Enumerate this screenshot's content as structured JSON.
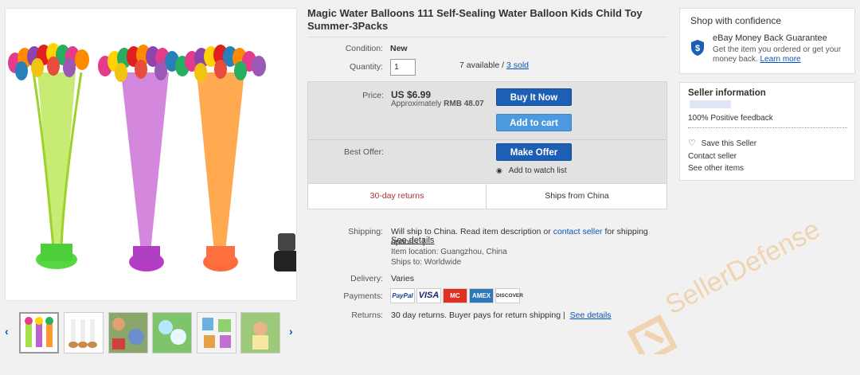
{
  "listing": {
    "title": "Magic Water Balloons 111 Self-Sealing Water Balloon Kids Child Toy Summer-3Packs"
  },
  "condition": {
    "label": "Condition:",
    "value": "New"
  },
  "quantity": {
    "label": "Quantity:",
    "value": "1",
    "available": "7 available /",
    "sold": "3 sold"
  },
  "price": {
    "label": "Price:",
    "value": "US $6.99",
    "approx_label": "Approximately",
    "approx_value": "RMB 48.07"
  },
  "buttons": {
    "buy_now": "Buy It Now",
    "add_to_cart": "Add to cart",
    "make_offer": "Make Offer",
    "watch": "Add to watch list"
  },
  "best_offer": {
    "label": "Best Offer:"
  },
  "strip": {
    "returns": "30-day returns",
    "ships_from": "Ships from China"
  },
  "shipping": {
    "label": "Shipping:",
    "text1": "Will ship to China. Read item description or",
    "contact": "contact seller",
    "text2": "for shipping options. |",
    "see_details": "See details",
    "item_location": "Item location:  Guangzhou, China",
    "ships_to": "Ships to:  Worldwide"
  },
  "delivery": {
    "label": "Delivery:",
    "value": "Varies"
  },
  "payments": {
    "label": "Payments:",
    "methods": [
      "PayPal",
      "VISA",
      "MC",
      "AMEX",
      "DISCOVER"
    ]
  },
  "returns": {
    "label": "Returns:",
    "text": "30 day returns. Buyer pays for return shipping |",
    "see_details": "See details"
  },
  "confidence": {
    "heading": "Shop with confidence",
    "guarantee_title": "eBay Money Back Guarantee",
    "guarantee_text": "Get the item you ordered or get your money back.",
    "learn_more": "Learn more"
  },
  "seller": {
    "heading": "Seller information",
    "feedback": "100% Positive feedback",
    "save": "Save this Seller",
    "contact": "Contact seller",
    "other_items": "See other items"
  },
  "watermark": "SellerDefense",
  "colors": {
    "link": "#0654ba",
    "button_dark": "#1c5fb5",
    "button_light": "#4b9ae0",
    "returns_red": "#a83232",
    "watermark": "#f0a040"
  }
}
